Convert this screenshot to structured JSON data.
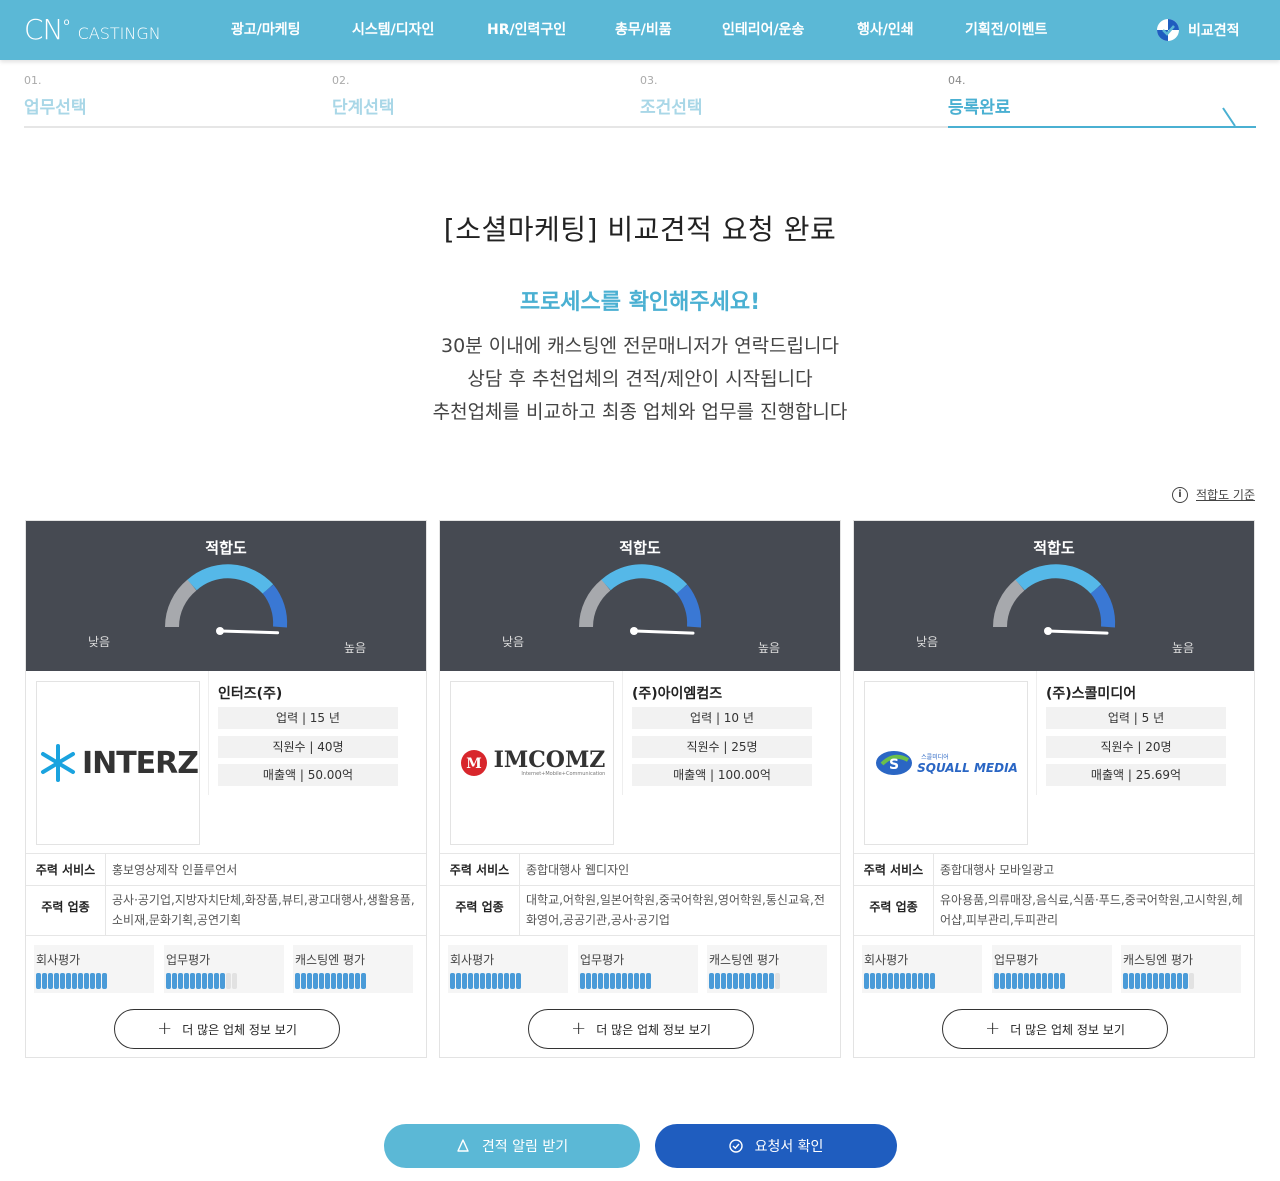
{
  "header": {
    "logo_mark": "CN",
    "logo_text": "CASTINGN",
    "nav": [
      "광고/마케팅",
      "시스템/디자인",
      "HR/인력구인",
      "총무/비품",
      "인테리어/운송",
      "행사/인쇄",
      "기획전/이벤트"
    ],
    "compare_label": "비교견적"
  },
  "steps": [
    {
      "num": "01.",
      "label": "업무선택"
    },
    {
      "num": "02.",
      "label": "단계선택"
    },
    {
      "num": "03.",
      "label": "조건선택"
    },
    {
      "num": "04.",
      "label": "등록완료"
    }
  ],
  "main": {
    "title": "[소셜마케팅] 비교견적 요청 완료",
    "subtitle": "프로세스를 확인해주세요!",
    "lines": [
      "30분 이내에 캐스팅엔 전문매니저가 연락드립니다",
      "상담 후 추천업체의 견적/제안이 시작됩니다",
      "추천업체를 비교하고 최종 업체와 업무를 진행합니다"
    ],
    "fit_link": "적합도 기준",
    "fit_icon": "i"
  },
  "card_labels": {
    "gauge_title": "적합도",
    "low": "낮음",
    "high": "높음",
    "service": "주력 서비스",
    "industry": "주력 업종",
    "rating_company": "회사평가",
    "rating_work": "업무평가",
    "rating_casting": "캐스팅엔 평가",
    "more": "더 많은 업체 정보 보기"
  },
  "cards": [
    {
      "name": "인터즈(주)",
      "logo_text": "INTERZ",
      "career": "업력 | 15 년",
      "staff": "직원수 | 40명",
      "sales": "매출액 | 50.00억",
      "service": "홍보영상제작 인플루언서",
      "industry": "공사·공기업,지방자치단체,화장품,뷰티,광고대행사,생활용품,소비재,문화기획,공연기획",
      "ratings": [
        1.0,
        0.8,
        1.0
      ],
      "gauge": 0.88
    },
    {
      "name": "(주)아이엠컴즈",
      "logo_text": "IMCOMZ",
      "logo_sub": "Internet+Mobile+Communication",
      "career": "업력 | 10 년",
      "staff": "직원수 | 25명",
      "sales": "매출액 | 100.00억",
      "service": "종합대행사 웹디자인",
      "industry": "대학교,어학원,일본어학원,중국어학원,영어학원,통신교육,전화영어,공공기관,공사·공기업",
      "ratings": [
        1.0,
        1.0,
        0.9
      ],
      "gauge": 0.9
    },
    {
      "name": "(주)스콜미디어",
      "logo_text": "SQUALL MEDIA",
      "logo_sub": "스콜미디어",
      "career": "업력 | 5 년",
      "staff": "직원수 | 20명",
      "sales": "매출액 | 25.69억",
      "service": "종합대행사 모바일광고",
      "industry": "유아용품,의류매장,음식료,식품·푸드,중국어학원,고시학원,헤어샵,피부관리,두피관리",
      "ratings": [
        1.0,
        1.0,
        0.9
      ],
      "gauge": 0.9
    }
  ],
  "buttons": {
    "alert": "견적 알림 받기",
    "confirm": "요청서 확인"
  },
  "colors": {
    "brand": "#5bb8d6",
    "gauge_bg": "#464a52",
    "confirm": "#1f5dbf",
    "rating": "#4a9bd8"
  }
}
